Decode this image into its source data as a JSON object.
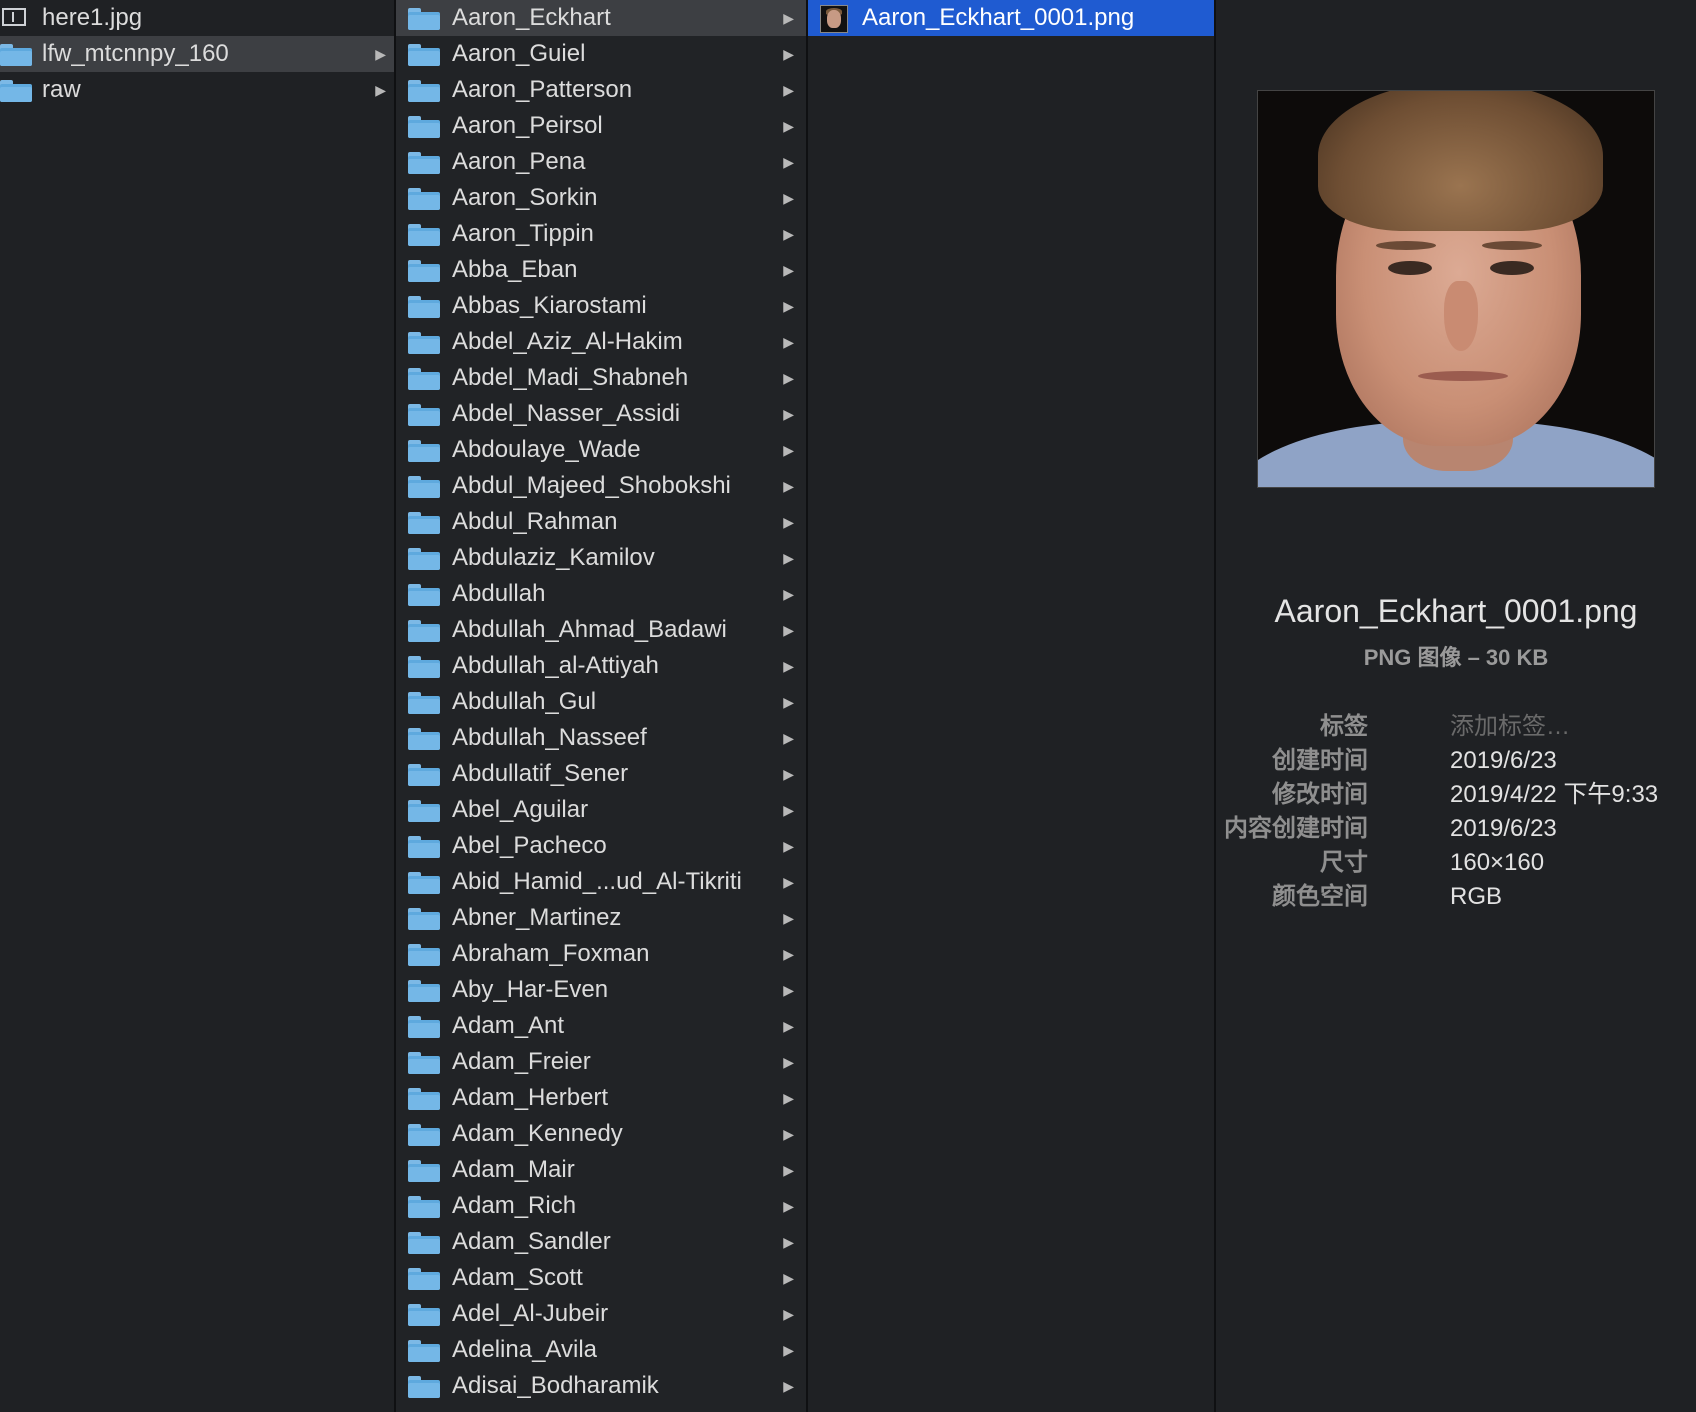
{
  "col1": {
    "items": [
      {
        "label": "here1.jpg",
        "icon": "image-icon",
        "state": "normal"
      },
      {
        "label": "lfw_mtcnnpy_160",
        "icon": "folder-icon",
        "state": "selected"
      },
      {
        "label": "raw",
        "icon": "folder-icon",
        "state": "normal"
      }
    ]
  },
  "col2": {
    "items": [
      {
        "label": "Aaron_Eckhart",
        "state": "selected"
      },
      {
        "label": "Aaron_Guiel"
      },
      {
        "label": "Aaron_Patterson"
      },
      {
        "label": "Aaron_Peirsol"
      },
      {
        "label": "Aaron_Pena"
      },
      {
        "label": "Aaron_Sorkin"
      },
      {
        "label": "Aaron_Tippin"
      },
      {
        "label": "Abba_Eban"
      },
      {
        "label": "Abbas_Kiarostami"
      },
      {
        "label": "Abdel_Aziz_Al-Hakim"
      },
      {
        "label": "Abdel_Madi_Shabneh"
      },
      {
        "label": "Abdel_Nasser_Assidi"
      },
      {
        "label": "Abdoulaye_Wade"
      },
      {
        "label": "Abdul_Majeed_Shobokshi"
      },
      {
        "label": "Abdul_Rahman"
      },
      {
        "label": "Abdulaziz_Kamilov"
      },
      {
        "label": "Abdullah"
      },
      {
        "label": "Abdullah_Ahmad_Badawi"
      },
      {
        "label": "Abdullah_al-Attiyah"
      },
      {
        "label": "Abdullah_Gul"
      },
      {
        "label": "Abdullah_Nasseef"
      },
      {
        "label": "Abdullatif_Sener"
      },
      {
        "label": "Abel_Aguilar"
      },
      {
        "label": "Abel_Pacheco"
      },
      {
        "label": "Abid_Hamid_...ud_Al-Tikriti"
      },
      {
        "label": "Abner_Martinez"
      },
      {
        "label": "Abraham_Foxman"
      },
      {
        "label": "Aby_Har-Even"
      },
      {
        "label": "Adam_Ant"
      },
      {
        "label": "Adam_Freier"
      },
      {
        "label": "Adam_Herbert"
      },
      {
        "label": "Adam_Kennedy"
      },
      {
        "label": "Adam_Mair"
      },
      {
        "label": "Adam_Rich"
      },
      {
        "label": "Adam_Sandler"
      },
      {
        "label": "Adam_Scott"
      },
      {
        "label": "Adel_Al-Jubeir"
      },
      {
        "label": "Adelina_Avila"
      },
      {
        "label": "Adisai_Bodharamik"
      }
    ]
  },
  "col3": {
    "items": [
      {
        "label": "Aaron_Eckhart_0001.png",
        "state": "selected-blue"
      }
    ]
  },
  "preview": {
    "filename": "Aaron_Eckhart_0001.png",
    "subtitle": "PNG 图像 – 30 KB",
    "tags_label": "标签",
    "tags_placeholder": "添加标签…",
    "created_label": "创建时间",
    "created_value": "2019/6/23",
    "modified_label": "修改时间",
    "modified_value": "2019/4/22 下午9:33",
    "content_created_label": "内容创建时间",
    "content_created_value": "2019/6/23",
    "size_label": "尺寸",
    "size_value": "160×160",
    "colorspace_label": "颜色空间",
    "colorspace_value": "RGB"
  },
  "colors": {
    "background": "#1f2124",
    "selection_blue": "#1f5bd1",
    "selection_gray": "#3d3f43",
    "folder_blue": "#74b7e7"
  }
}
